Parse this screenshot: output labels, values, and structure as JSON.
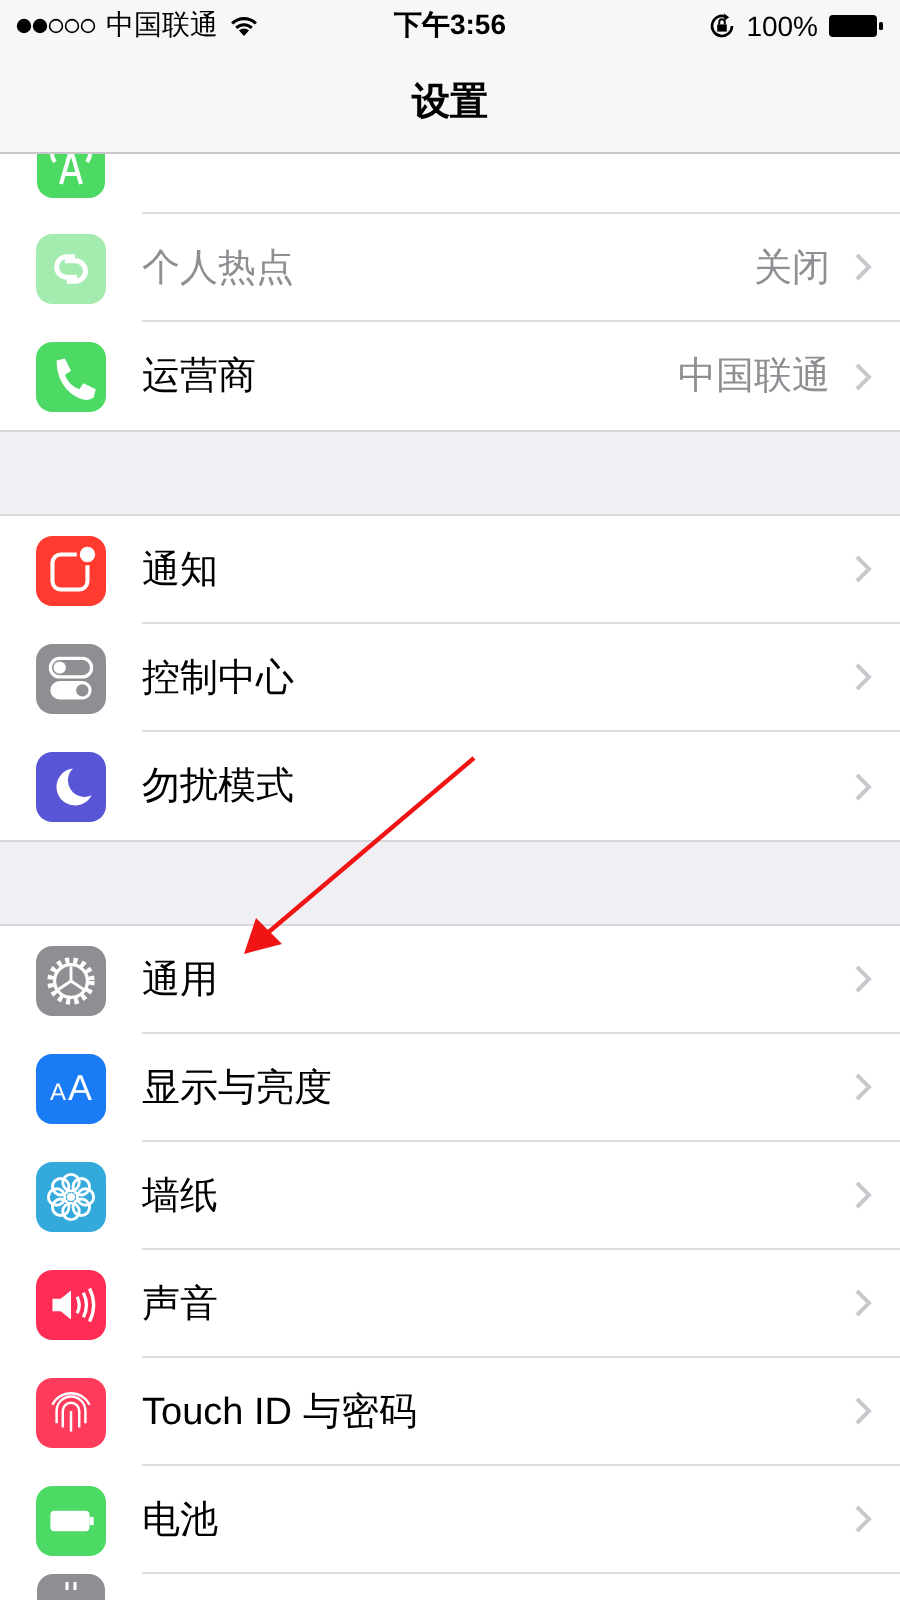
{
  "status_bar": {
    "carrier": "中国联通",
    "time": "下午3:56",
    "battery": "100%"
  },
  "nav": {
    "title": "设置"
  },
  "sections": [
    {
      "items": [
        {
          "kind": "partial",
          "disabled": false
        },
        {
          "kind": "row",
          "label": "个人热点",
          "value": "关闭",
          "disabled": true
        },
        {
          "kind": "row",
          "label": "运营商",
          "value": "中国联通",
          "disabled": false
        }
      ]
    },
    {
      "items": [
        {
          "kind": "row",
          "label": "通知",
          "disabled": false
        },
        {
          "kind": "row",
          "label": "控制中心",
          "disabled": false
        },
        {
          "kind": "row",
          "label": "勿扰模式",
          "disabled": false
        }
      ]
    },
    {
      "items": [
        {
          "kind": "row",
          "label": "通用",
          "disabled": false
        },
        {
          "kind": "row",
          "label": "显示与亮度",
          "icon_text": "AA",
          "disabled": false
        },
        {
          "kind": "row",
          "label": "墙纸",
          "disabled": false
        },
        {
          "kind": "row",
          "label": "声音",
          "disabled": false
        },
        {
          "kind": "row",
          "label": "Touch ID 与密码",
          "disabled": false
        },
        {
          "kind": "row",
          "label": "电池",
          "disabled": false
        },
        {
          "kind": "partial",
          "disabled": false
        }
      ]
    }
  ]
}
